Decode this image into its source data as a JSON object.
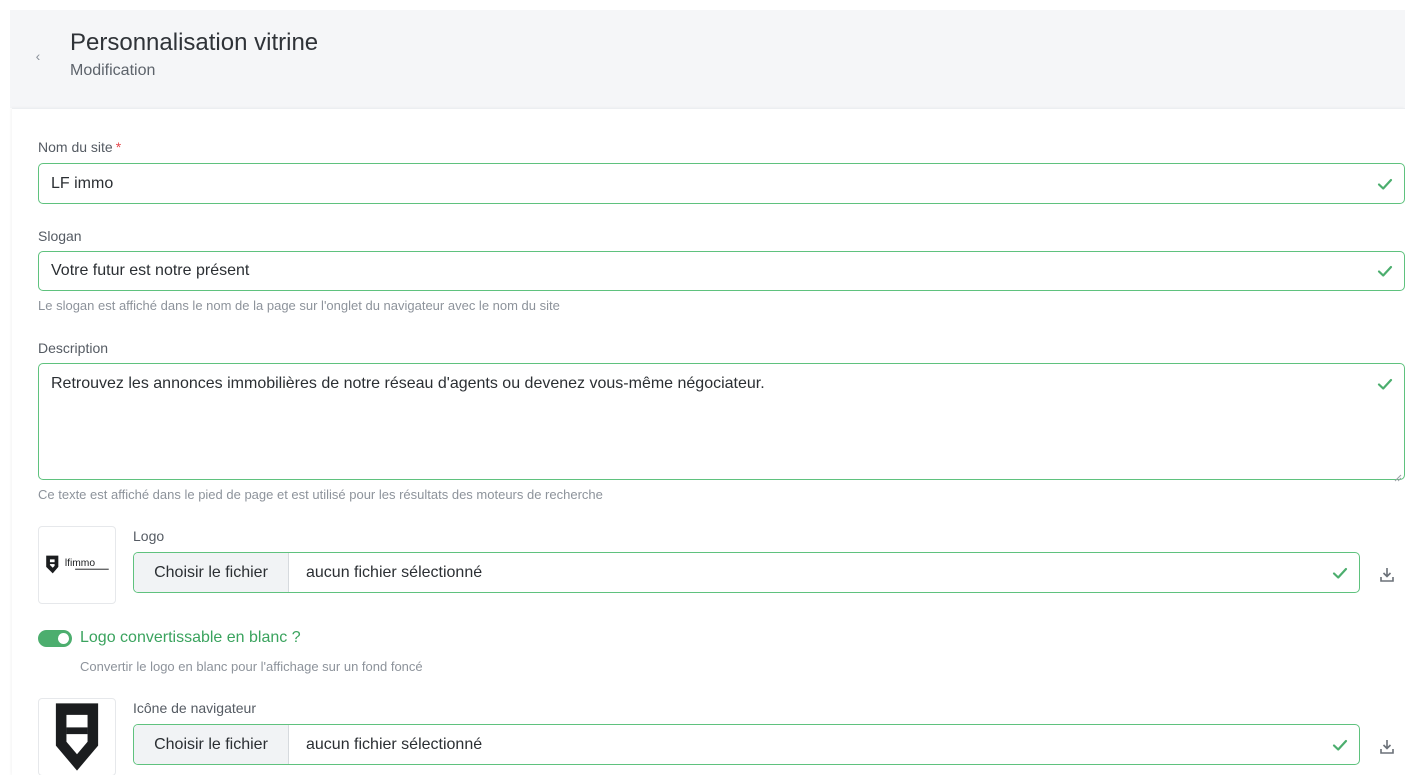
{
  "header": {
    "title": "Personnalisation vitrine",
    "subtitle": "Modification",
    "back_glyph": "‹"
  },
  "form": {
    "site_name": {
      "label": "Nom du site",
      "required_mark": "*",
      "value": "LF immo"
    },
    "slogan": {
      "label": "Slogan",
      "value": "Votre futur est notre présent",
      "help": "Le slogan est affiché dans le nom de la page sur l'onglet du navigateur avec le nom du site"
    },
    "description": {
      "label": "Description",
      "value": "Retrouvez les annonces immobilières de notre réseau d'agents ou devenez vous-même négociateur.",
      "help": "Ce texte est affiché dans le pied de page et est utilisé pour les résultats des moteurs de recherche"
    },
    "logo": {
      "label": "Logo",
      "choose_label": "Choisir le fichier",
      "file_status": "aucun fichier sélectionné",
      "preview_text": "lfimmo"
    },
    "logo_white": {
      "label": "Logo convertissable en blanc ?",
      "help": "Convertir le logo en blanc pour l'affichage sur un fond foncé",
      "enabled": true
    },
    "favicon": {
      "label": "Icône de navigateur",
      "choose_label": "Choisir le fichier",
      "file_status": "aucun fichier sélectionné"
    }
  },
  "icons": {
    "valid": "check-icon",
    "download": "download-icon",
    "back": "chevron-left-icon"
  },
  "colors": {
    "valid_border": "#5fc27e",
    "toggle_on": "#4cae6e",
    "toggle_label": "#3aa35e",
    "required": "#e5484d"
  }
}
